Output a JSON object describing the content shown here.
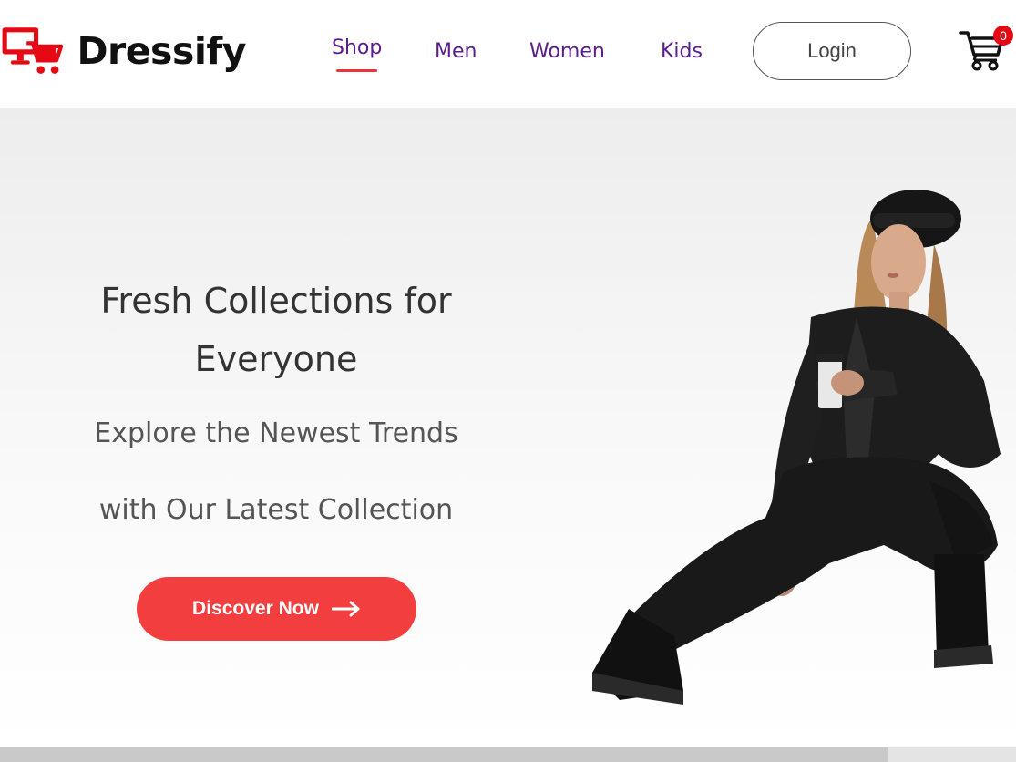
{
  "brand": {
    "name": "Dressify",
    "accent": "#e50914"
  },
  "nav": {
    "items": [
      {
        "label": "Shop",
        "active": true
      },
      {
        "label": "Men",
        "active": false
      },
      {
        "label": "Women",
        "active": false
      },
      {
        "label": "Kids",
        "active": false
      }
    ],
    "link_color": "#5b1c8c",
    "active_underline_color": "#e8343a"
  },
  "header": {
    "login_label": "Login",
    "cart_icon": "cart-icon",
    "cart_count": "0"
  },
  "hero": {
    "title_line1": "Fresh Collections for",
    "title_line2": "Everyone",
    "subtitle_line1": "Explore the Newest Trends",
    "subtitle_line2": "with Our Latest Collection",
    "cta_label": "Discover Now",
    "cta_icon": "arrow-right-icon",
    "cta_color": "#f23e3e"
  }
}
